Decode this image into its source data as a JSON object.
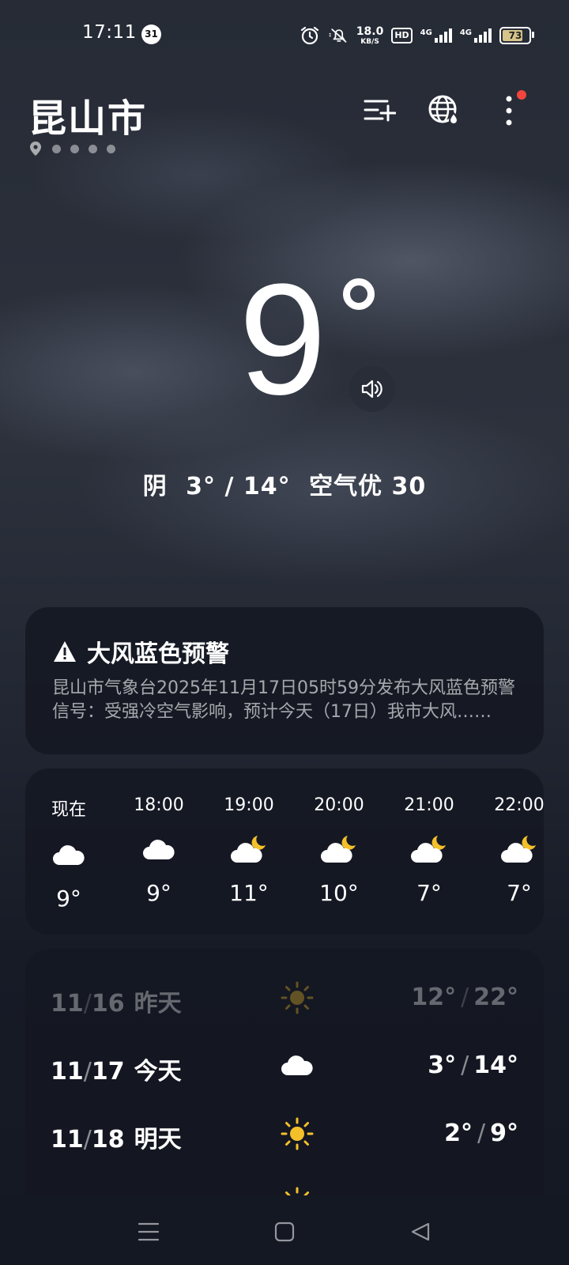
{
  "status_bar": {
    "time": "17:11",
    "notification_count": "31",
    "net_speed_value": "18.0",
    "net_speed_unit": "KB/S",
    "hd_label": "HD",
    "sim1_label": "4G",
    "sim2_label": "4G",
    "battery_level": "73"
  },
  "header": {
    "city": "昆山市",
    "page_dots": 4
  },
  "current": {
    "temperature": "9",
    "condition": "阴",
    "range": "3° / 14°",
    "air_quality": "空气优 30"
  },
  "alert": {
    "title": "大风蓝色预警",
    "body": "昆山市气象台2025年11月17日05时59分发布大风蓝色预警信号：受强冷空气影响，预计今天（17日）我市大风……"
  },
  "hourly": [
    {
      "time": "现在",
      "icon": "cloudy-icon",
      "temp": "9°"
    },
    {
      "time": "18:00",
      "icon": "cloudy-icon",
      "temp": "9°"
    },
    {
      "time": "19:00",
      "icon": "cloudy-night-icon",
      "temp": "11°"
    },
    {
      "time": "20:00",
      "icon": "cloudy-night-icon",
      "temp": "10°"
    },
    {
      "time": "21:00",
      "icon": "cloudy-night-icon",
      "temp": "7°"
    },
    {
      "time": "22:00",
      "icon": "cloudy-night-icon",
      "temp": "7°"
    }
  ],
  "daily": [
    {
      "month": "11",
      "day": "16",
      "label": "昨天",
      "icon": "sunny-icon",
      "low": "12°",
      "high": "22°"
    },
    {
      "month": "11",
      "day": "17",
      "label": "今天",
      "icon": "cloudy-icon",
      "low": "3°",
      "high": "14°"
    },
    {
      "month": "11",
      "day": "18",
      "label": "明天",
      "icon": "sunny-icon",
      "low": "2°",
      "high": "9°"
    }
  ],
  "colors": {
    "sun": "#f4c02a",
    "moon": "#f4c02a",
    "alert_red": "#f2453d"
  }
}
